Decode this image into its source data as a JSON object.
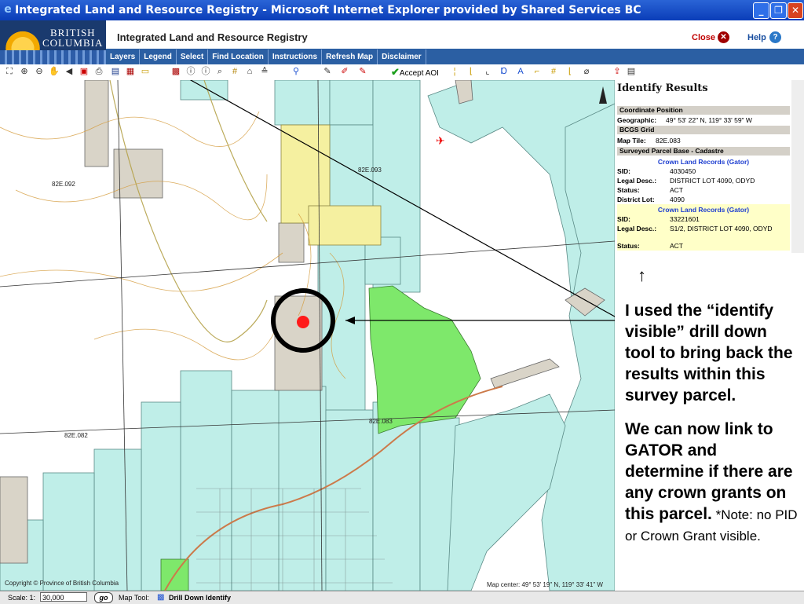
{
  "window": {
    "title": "Integrated Land and Resource Registry - Microsoft Internet Explorer provided by Shared Services BC",
    "minimize": "_",
    "maximize": "❐",
    "close": "✕"
  },
  "header": {
    "logo_line1": "BRITISH",
    "logo_line2": "COLUMBIA",
    "app_title": "Integrated Land and Resource Registry",
    "close_label": "Close",
    "help_label": "Help"
  },
  "menu": [
    "Layers",
    "Legend",
    "Select",
    "Find Location",
    "Instructions",
    "Refresh Map",
    "Disclaimer"
  ],
  "toolbar": {
    "accept_aoi": "Accept AOI"
  },
  "map": {
    "labels": [
      "82E.092",
      "82E.093",
      "82E.082",
      "82E.083"
    ],
    "copyright": "Copyright © Province of British Columbia",
    "map_center": "Map center: 49° 53' 19\" N, 119° 33' 41\" W"
  },
  "identify": {
    "title": "Identify Results",
    "coord_header": "Coordinate Position",
    "geographic_key": "Geographic:",
    "geographic_val": "49° 53' 22\" N, 119° 33' 59\" W",
    "bcgs_header": "BCGS Grid",
    "map_tile_key": "Map Tile:",
    "map_tile_val": "82E.083",
    "cadastre_header": "Surveyed Parcel Base - Cadastre",
    "records": [
      {
        "link": "Crown Land Records (Gator)",
        "sid_key": "SID:",
        "sid_val": "4030450",
        "legal_key": "Legal Desc.:",
        "legal_val": "DISTRICT LOT 4090, ODYD",
        "status_key": "Status:",
        "status_val": "ACT",
        "dl_key": "District Lot:",
        "dl_val": "4090"
      },
      {
        "link": "Crown Land Records (Gator)",
        "sid_key": "SID:",
        "sid_val": "33221601",
        "legal_key": "Legal Desc.:",
        "legal_val": "S1/2, DISTRICT LOT 4090, ODYD",
        "status_key": "Status:",
        "status_val": "ACT"
      }
    ]
  },
  "annotation": {
    "arrow": "↑",
    "para1": "I used the “identify visible” drill down tool to bring back the results within this survey parcel.",
    "para2_bold": "We can now link to GATOR and determine if there are any crown grants on this parcel.",
    "para2_note": " *Note: no PID or Crown Grant visible."
  },
  "status": {
    "scale_label": "Scale: 1:",
    "scale_value": "30,000",
    "go_label": "go",
    "map_tool_label": "Map Tool:",
    "map_tool_value": "Drill Down Identify"
  },
  "colors": {
    "titlebar": "#0a3db8",
    "menubar": "#2b5fa3",
    "parcel_cyan": "#bfeee8",
    "parcel_green": "#7ee86b",
    "parcel_yellow": "#f5f0a0",
    "parcel_grey": "#d9d4c8"
  }
}
